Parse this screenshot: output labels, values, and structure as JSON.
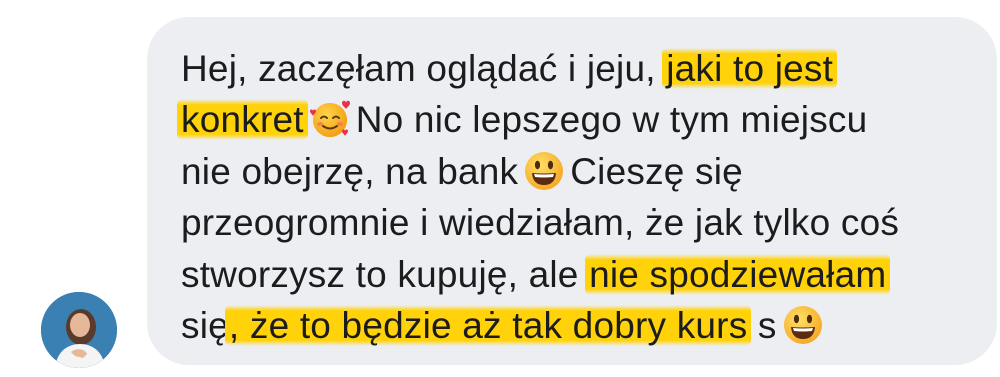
{
  "sender": {
    "avatar_icon": "user-photo-avatar"
  },
  "message": {
    "line1": {
      "plain": "Hej, zaczęłam oglądać i jeju, ",
      "highlight": "jaki to jest"
    },
    "line2": {
      "highlight": "konkret",
      "emoji": "smiling-face-with-hearts-emoji",
      "plain": "No nic lepszego w tym miejscu"
    },
    "line3": {
      "plain_before": "nie obejrzę, na bank",
      "emoji": "grinning-face-emoji",
      "plain_after": "Cieszę się"
    },
    "line4": {
      "plain": "przeogromnie i wiedziałam, że jak tylko coś"
    },
    "line5": {
      "plain": "stworzysz to kupuję, ale ",
      "highlight": "nie spodziewałam"
    },
    "line6": {
      "plain_before": "się",
      "highlight": ", że to będzie aż tak dobry kurs",
      "plain_after": " s",
      "emoji": "grinning-face-emoji"
    }
  },
  "colors": {
    "bubble": "#eceef1",
    "text": "#1c1c1e",
    "highlight": "#ffd20a"
  }
}
